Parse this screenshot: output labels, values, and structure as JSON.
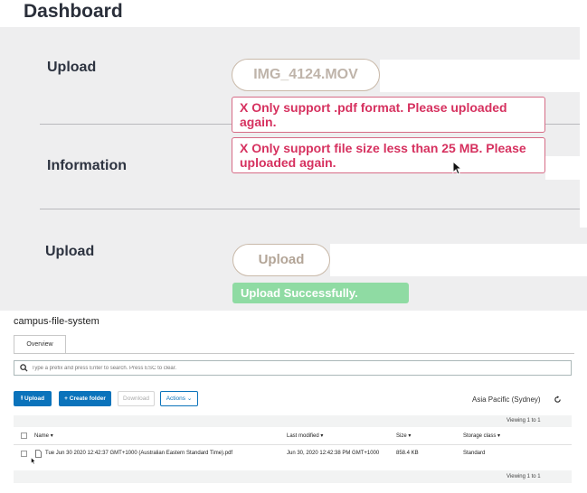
{
  "panel1": {
    "title": "Dashboard",
    "upload_label": "Upload",
    "file_chip": "IMG_4124.MOV",
    "errors": [
      "X Only support .pdf format. Please uploaded again.",
      "X Only support file size less than 25 MB. Please uploaded again."
    ],
    "information_label": "Information"
  },
  "panel2": {
    "upload_label": "Upload",
    "upload_button": "Upload",
    "success_message": "Upload Successfully."
  },
  "console": {
    "bucket_name": "campus-file-system",
    "tab_overview": "Overview",
    "search_placeholder": "Type a prefix and press Enter to search. Press ESC to clear.",
    "buttons": {
      "upload": "Upload",
      "create_folder": "Create folder",
      "download": "Download",
      "actions": "Actions"
    },
    "region": "Asia Pacific (Sydney)",
    "viewing_top": "Viewing 1 to 1",
    "viewing_bottom": "Viewing 1 to 1",
    "columns": {
      "name": "Name",
      "last_modified": "Last modified",
      "size": "Size",
      "storage_class": "Storage class"
    },
    "rows": [
      {
        "name": "Tue Jun 30 2020 12:42:37 GMT+1000 (Australian Eastern Standard Time).pdf",
        "last_modified": "Jun 30, 2020 12:42:38 PM GMT+1000",
        "size": "858.4 KB",
        "storage_class": "Standard"
      }
    ]
  },
  "colors": {
    "error_text": "#d6315f",
    "error_border": "#d66b86",
    "success_bg": "#8fdba3",
    "aws_blue": "#0b73bb"
  }
}
